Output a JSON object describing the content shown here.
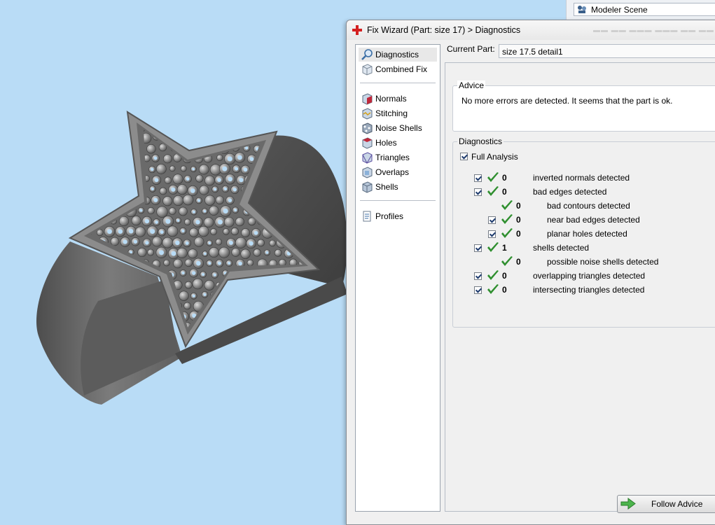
{
  "scene_tab": {
    "label": "Modeler Scene",
    "icon": "modeler-scene-icon"
  },
  "wizard": {
    "title": "Fix Wizard (Part: size 17) > Diagnostics",
    "title_icon": "red-cross-icon",
    "nav": [
      {
        "label": "Diagnostics",
        "icon": "magnifier-icon",
        "selected": true
      },
      {
        "label": "Combined Fix",
        "icon": "cube-icon"
      },
      {
        "label": "Normals",
        "icon": "normals-cube-icon"
      },
      {
        "label": "Stitching",
        "icon": "stitching-cube-icon"
      },
      {
        "label": "Noise Shells",
        "icon": "noise-shells-icon"
      },
      {
        "label": "Holes",
        "icon": "holes-cube-icon"
      },
      {
        "label": "Triangles",
        "icon": "triangles-cube-icon"
      },
      {
        "label": "Overlaps",
        "icon": "overlaps-cube-icon"
      },
      {
        "label": "Shells",
        "icon": "shells-cube-icon"
      },
      {
        "label": "Profiles",
        "icon": "document-icon"
      }
    ],
    "current_part": {
      "label": "Current Part:",
      "value": "size 17.5 detail1"
    },
    "advice": {
      "title": "Advice",
      "text": "No more errors are detected. It seems that the part is ok."
    },
    "diagnostics": {
      "title": "Diagnostics",
      "full_analysis": {
        "label": "Full Analysis",
        "checked": true
      },
      "rows": [
        {
          "count": "0",
          "label": "inverted normals detected",
          "level": 0,
          "checkbox": true
        },
        {
          "count": "0",
          "label": "bad edges detected",
          "level": 0,
          "checkbox": true
        },
        {
          "count": "0",
          "label": "bad contours detected",
          "level": 1,
          "checkbox": false
        },
        {
          "count": "0",
          "label": "near bad edges detected",
          "level": 1,
          "checkbox": true
        },
        {
          "count": "0",
          "label": "planar holes detected",
          "level": 1,
          "checkbox": true
        },
        {
          "count": "1",
          "label": "shells detected",
          "level": 0,
          "checkbox": true
        },
        {
          "count": "0",
          "label": "possible noise shells detected",
          "level": 1,
          "checkbox": false
        },
        {
          "count": "0",
          "label": "overlapping triangles detected",
          "level": 0,
          "checkbox": true
        },
        {
          "count": "0",
          "label": "intersecting triangles detected",
          "level": 0,
          "checkbox": true
        }
      ]
    },
    "follow_advice_label": "Follow Advice"
  },
  "colors": {
    "viewport_bg": "#b9dcf6",
    "check_green": "#2f8f2f",
    "ring_gray": "#6e6e6e"
  }
}
